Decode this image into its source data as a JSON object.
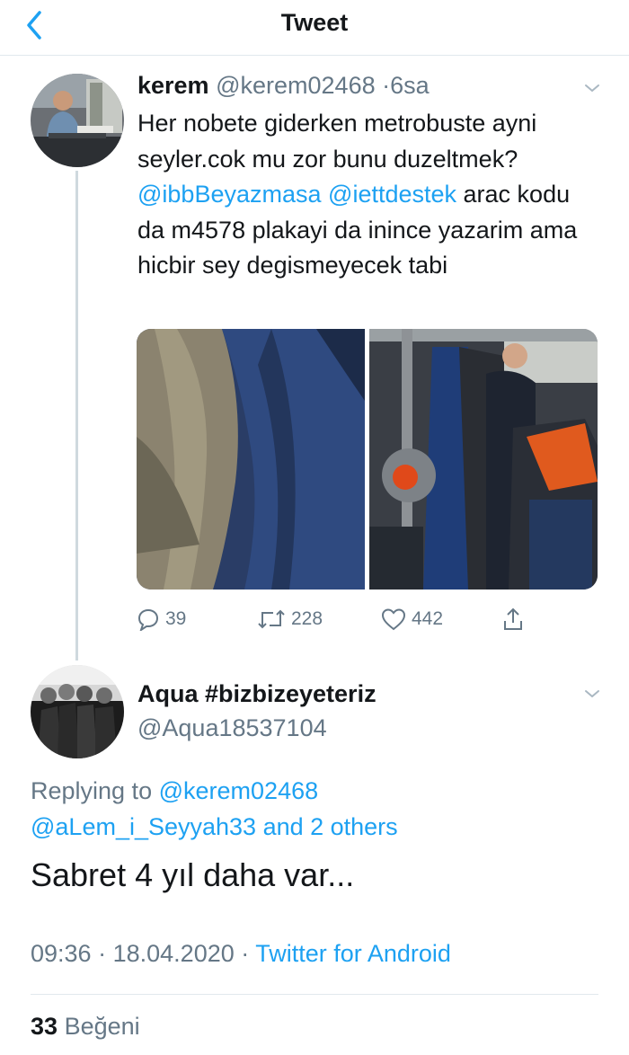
{
  "header": {
    "title": "Tweet"
  },
  "tweet": {
    "name": "kerem",
    "handle": "@kerem02468",
    "separator": "·",
    "time": "6sa",
    "text_part1": "Her nobete giderken metrobuste ayni seyler.cok mu zor bunu duzeltmek?",
    "mention1": "@ibbBeyazmasa",
    "mention2": "@iettdestek",
    "text_part2": "arac kodu da m4578 plakayi da inince yazarim ama hicbir sey degismeyecek tabi",
    "reply_count": "39",
    "retweet_count": "228",
    "like_count": "442"
  },
  "reply": {
    "name": "Aqua #bizbizeyeteriz",
    "handle": "@Aqua18537104",
    "replying_prefix": "Replying to",
    "replying_to": "@kerem02468",
    "replying_more": "@aLem_i_Seyyah33 and 2 others",
    "text": "Sabret 4 yıl daha var...",
    "time": "09:36",
    "dot": "·",
    "date": "18.04.2020",
    "source": "Twitter for Android",
    "likes_count": "33",
    "likes_label": "Beğeni"
  },
  "icons": {
    "back": "chevron-left-icon",
    "more": "chevron-down-icon",
    "reply": "comment-icon",
    "retweet": "retweet-icon",
    "like": "heart-icon",
    "share": "share-icon"
  },
  "colors": {
    "link": "#1da1f2",
    "muted": "#657786",
    "text": "#14171a"
  }
}
